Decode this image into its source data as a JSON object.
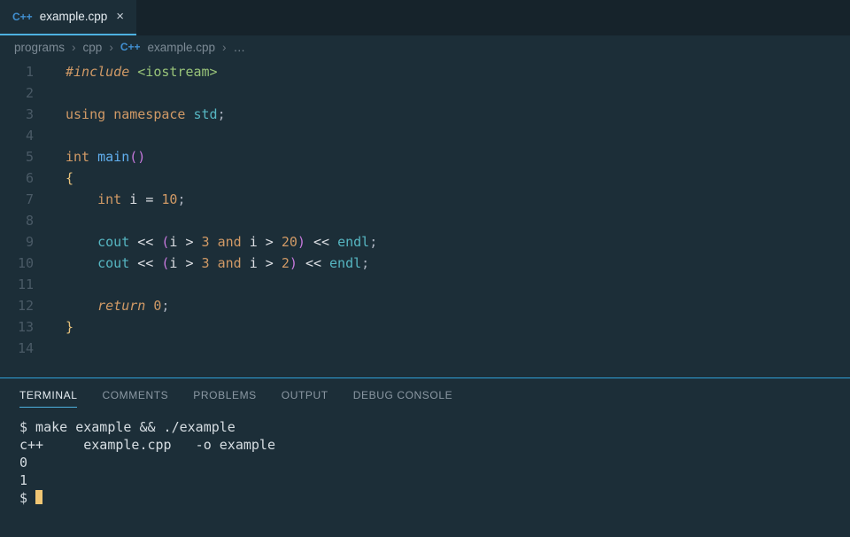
{
  "tab": {
    "icon_label": "C++",
    "filename": "example.cpp",
    "close": "×"
  },
  "breadcrumb": {
    "seg0": "programs",
    "seg1": "cpp",
    "icon_label": "C++",
    "seg2": "example.cpp",
    "dots": "…",
    "chev": "›"
  },
  "gutter": [
    "1",
    "2",
    "3",
    "4",
    "5",
    "6",
    "7",
    "8",
    "9",
    "10",
    "11",
    "12",
    "13",
    "14",
    ""
  ],
  "code": {
    "l1_include": "#include",
    "l1_header": "<iostream>",
    "l3_using": "using",
    "l3_namespace": "namespace",
    "l3_std": "std",
    "l5_int": "int",
    "l5_main": "main",
    "l6_brace_open": "{",
    "l7_int": "int",
    "l7_id": "i",
    "l7_eq": "=",
    "l7_val": "10",
    "l9_cout": "cout",
    "l9_i1": "i",
    "l9_gt1": ">",
    "l9_n1": "3",
    "l9_and": "and",
    "l9_i2": "i",
    "l9_gt2": ">",
    "l9_n2": "20",
    "l9_endl": "endl",
    "l10_cout": "cout",
    "l10_i1": "i",
    "l10_gt1": ">",
    "l10_n1": "3",
    "l10_and": "and",
    "l10_i2": "i",
    "l10_gt2": ">",
    "l10_n2": "2",
    "l10_endl": "endl",
    "l12_return": "return",
    "l12_zero": "0",
    "l13_brace_close": "}",
    "semi": ";",
    "ltlt": "<<",
    "paren_o": "(",
    "paren_c": ")"
  },
  "panel": {
    "tabs": {
      "terminal": "TERMINAL",
      "comments": "COMMENTS",
      "problems": "PROBLEMS",
      "output": "OUTPUT",
      "debug": "DEBUG CONSOLE"
    },
    "lines": [
      "$ make example && ./example",
      "c++     example.cpp   -o example",
      "0",
      "1"
    ],
    "prompt": "$ "
  }
}
